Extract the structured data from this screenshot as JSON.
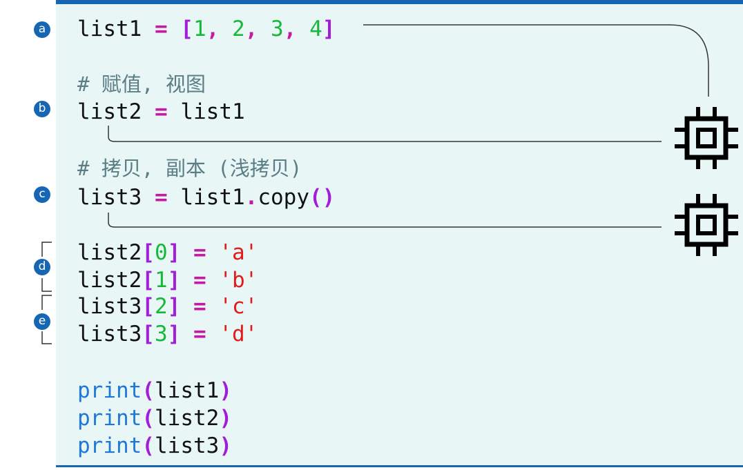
{
  "colors": {
    "accent": "#1766b4",
    "background": "#e9f6f6",
    "operator": "#c51ba1",
    "bracket": "#a11dd8",
    "number": "#16b83a",
    "string": "#e11b1b",
    "keyword": "#1f78d8",
    "comment": "#5a7d86"
  },
  "markers": [
    "a",
    "b",
    "c",
    "d",
    "e"
  ],
  "icons": [
    "memory-chip-icon",
    "memory-chip-icon"
  ],
  "code": {
    "line1": {
      "name": "list1",
      "eq": "=",
      "open": "[",
      "n1": "1",
      "n2": "2",
      "n3": "3",
      "n4": "4",
      "comma": ",",
      "close": "]"
    },
    "comment_b": "# 赋值, 视图",
    "line2": {
      "name": "list2",
      "eq": "=",
      "value": "list1"
    },
    "comment_c": "# 拷贝, 副本 (浅拷贝)",
    "line3": {
      "name": "list3",
      "eq": "=",
      "obj": "list1",
      "dot": ".",
      "method": "copy",
      "paren": "()"
    },
    "assignments": [
      {
        "name": "list2",
        "open": "[",
        "index": "0",
        "close": "]",
        "eq": "=",
        "value": "'a'"
      },
      {
        "name": "list2",
        "open": "[",
        "index": "1",
        "close": "]",
        "eq": "=",
        "value": "'b'"
      },
      {
        "name": "list3",
        "open": "[",
        "index": "2",
        "close": "]",
        "eq": "=",
        "value": "'c'"
      },
      {
        "name": "list3",
        "open": "[",
        "index": "3",
        "close": "]",
        "eq": "=",
        "value": "'d'"
      }
    ],
    "prints": [
      {
        "fn": "print",
        "open": "(",
        "arg": "list1",
        "close": ")"
      },
      {
        "fn": "print",
        "open": "(",
        "arg": "list2",
        "close": ")"
      },
      {
        "fn": "print",
        "open": "(",
        "arg": "list3",
        "close": ")"
      }
    ]
  }
}
